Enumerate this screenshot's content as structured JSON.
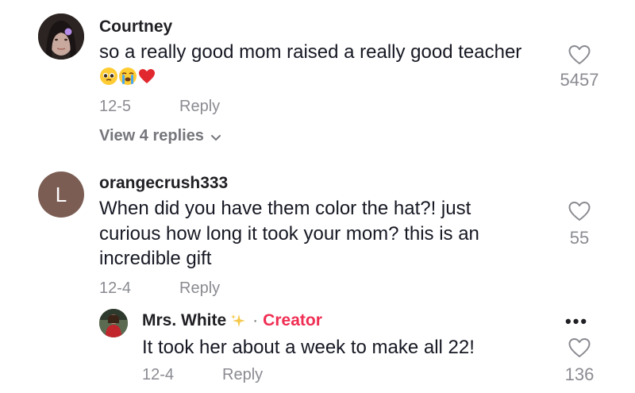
{
  "comments": [
    {
      "username": "Courtney",
      "text": "so a really good mom raised a really good teacher",
      "date": "12-5",
      "reply_label": "Reply",
      "likes": "5457",
      "view_replies": "View 4 replies"
    },
    {
      "username": "orangecrush333",
      "avatar_letter": "L",
      "text_lines": [
        "When did you have them color the hat?! just",
        "curious how long it took your mom? this is an",
        "incredible gift"
      ],
      "date": "12-4",
      "reply_label": "Reply",
      "likes": "55"
    }
  ],
  "reply": {
    "username": "Mrs. White",
    "separator": "·",
    "creator_label": "Creator",
    "text": "It took her about a week to make all 22!",
    "date": "12-4",
    "reply_label": "Reply",
    "likes": "136",
    "more_icon": "•••"
  },
  "colors": {
    "creator": "#f02d52",
    "muted": "#8a8b91",
    "avatar_l": "#7b5d53",
    "heart_red": "#e0282e"
  }
}
